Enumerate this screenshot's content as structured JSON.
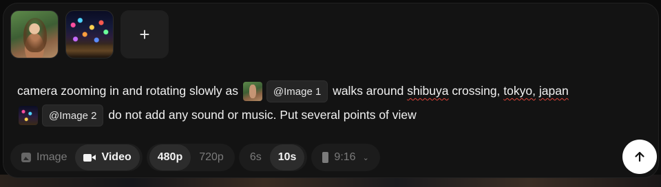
{
  "attachments": [
    {
      "name": "Image 1",
      "icon": "portrait-photo"
    },
    {
      "name": "Image 2",
      "icon": "city-night-photo"
    }
  ],
  "add_button": {
    "label": "+"
  },
  "prompt": {
    "seg1": "camera zooming in and rotating slowly as",
    "ref1": "@Image 1",
    "seg2_a": "walks around",
    "seg2_b": "shibuya",
    "seg2_c": "crossing,",
    "seg2_d": "tokyo,",
    "seg2_e": "japan",
    "ref2": "@Image 2",
    "seg3": "do not add any sound or music. Put several points of view"
  },
  "toolbar": {
    "media": {
      "image": "Image",
      "video": "Video",
      "selected": "Video"
    },
    "resolution": {
      "options": [
        "480p",
        "720p"
      ],
      "selected": "480p"
    },
    "duration": {
      "options": [
        "6s",
        "10s"
      ],
      "selected": "10s"
    },
    "aspect": {
      "value": "9:16",
      "chevron": "⌄"
    }
  },
  "submit": {
    "icon": "arrow-up-icon"
  },
  "colors": {
    "panel": "#131313",
    "chip": "#252525",
    "active": "#2c2c2c",
    "spellcheck": "#e0453a"
  }
}
